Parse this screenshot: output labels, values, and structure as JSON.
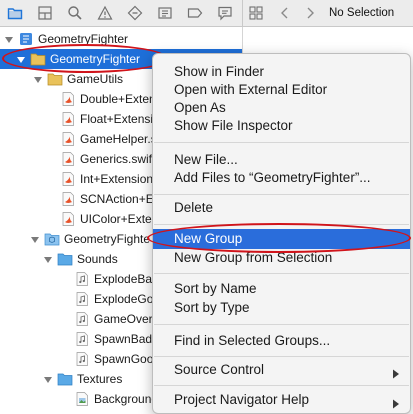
{
  "toolbar": {
    "navigator_icons": [
      "folder-icon",
      "source-control-icon",
      "search-icon",
      "warning-icon",
      "test-diamond-icon",
      "debug-icon",
      "breakpoint-icon",
      "report-icon"
    ],
    "jump_bar_title": "No Selection"
  },
  "navigator": {
    "rows": [
      {
        "label": "GeometryFighter",
        "kind": "project",
        "expanded": true,
        "selected": false
      },
      {
        "label": "GeometryFighter",
        "kind": "group",
        "expanded": true,
        "selected": true
      },
      {
        "label": "GameUtils",
        "kind": "group",
        "expanded": true,
        "selected": false
      },
      {
        "label": "Double+Exten",
        "kind": "swift",
        "selected": false
      },
      {
        "label": "Float+Extensic",
        "kind": "swift",
        "selected": false
      },
      {
        "label": "GameHelper.s",
        "kind": "swift",
        "selected": false
      },
      {
        "label": "Generics.swift",
        "kind": "swift",
        "selected": false
      },
      {
        "label": "Int+Extensions",
        "kind": "swift",
        "selected": false
      },
      {
        "label": "SCNAction+Ex",
        "kind": "swift",
        "selected": false
      },
      {
        "label": "UIColor+Exter",
        "kind": "swift",
        "selected": false
      },
      {
        "label": "GeometryFighte",
        "kind": "scnassets",
        "expanded": true,
        "selected": false
      },
      {
        "label": "Sounds",
        "kind": "folder",
        "expanded": true,
        "selected": false
      },
      {
        "label": "ExplodeBac",
        "kind": "audio",
        "selected": false
      },
      {
        "label": "ExplodeGoo",
        "kind": "audio",
        "selected": false
      },
      {
        "label": "GameOver.",
        "kind": "audio",
        "selected": false
      },
      {
        "label": "SpawnBad.",
        "kind": "audio",
        "selected": false
      },
      {
        "label": "SpawnGood",
        "kind": "audio",
        "selected": false
      },
      {
        "label": "Textures",
        "kind": "folder",
        "expanded": true,
        "selected": false
      },
      {
        "label": "Background",
        "kind": "image",
        "selected": false
      }
    ]
  },
  "context_menu": {
    "items": [
      {
        "label": "Show in Finder",
        "type": "item"
      },
      {
        "label": "Open with External Editor",
        "type": "item"
      },
      {
        "label": "Open As",
        "type": "submenu"
      },
      {
        "label": "Show File Inspector",
        "type": "item"
      },
      {
        "type": "separator"
      },
      {
        "label": "New File...",
        "type": "item"
      },
      {
        "label": "Add Files to “GeometryFighter”...",
        "type": "item"
      },
      {
        "type": "separator"
      },
      {
        "label": "Delete",
        "type": "item"
      },
      {
        "type": "separator"
      },
      {
        "label": "New Group",
        "type": "item",
        "highlighted": true
      },
      {
        "label": "New Group from Selection",
        "type": "item"
      },
      {
        "type": "separator"
      },
      {
        "label": "Sort by Name",
        "type": "item"
      },
      {
        "label": "Sort by Type",
        "type": "item"
      },
      {
        "type": "separator"
      },
      {
        "label": "Find in Selected Groups...",
        "type": "item"
      },
      {
        "type": "separator"
      },
      {
        "label": "Source Control",
        "type": "submenu"
      },
      {
        "type": "separator"
      },
      {
        "label": "Project Navigator Help",
        "type": "submenu"
      }
    ]
  },
  "colors": {
    "selection": "#1e6fd9",
    "menu_highlight": "#2a6ddb",
    "annotation_red": "#d0141b",
    "swift_orange": "#e8542c",
    "group_folder_yellow": "#e9c25a",
    "folder_blue": "#5aa9e6"
  }
}
